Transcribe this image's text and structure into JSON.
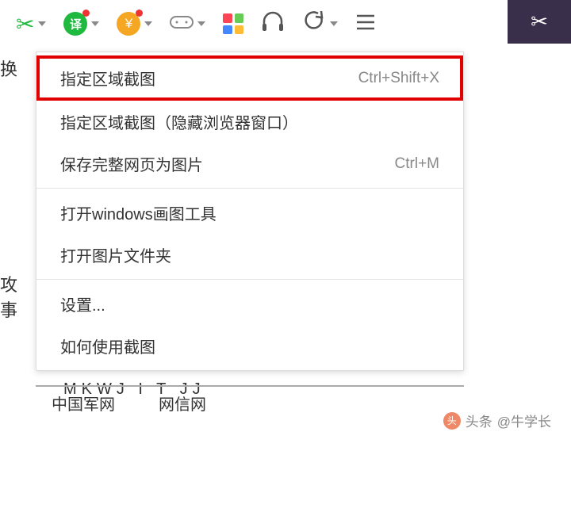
{
  "toolbar": {
    "translate_label": "译",
    "currency_label": "¥"
  },
  "menu": {
    "item1": {
      "label": "指定区域截图",
      "shortcut": "Ctrl+Shift+X"
    },
    "item2": {
      "label": "指定区域截图（隐藏浏览器窗口）"
    },
    "item3": {
      "label": "保存完整网页为图片",
      "shortcut": "Ctrl+M"
    },
    "item4": {
      "label": "打开windows画图工具"
    },
    "item5": {
      "label": "打开图片文件夹"
    },
    "item6": {
      "label": "设置..."
    },
    "item7": {
      "label": "如何使用截图"
    }
  },
  "left": {
    "char1": "换",
    "char2": "攻事"
  },
  "bottom": {
    "cut": "MKWJ    I T    JJ",
    "link1": "中国军网",
    "link2": "网信网"
  },
  "watermark": {
    "prefix": "头条",
    "user": "@牛学长"
  }
}
